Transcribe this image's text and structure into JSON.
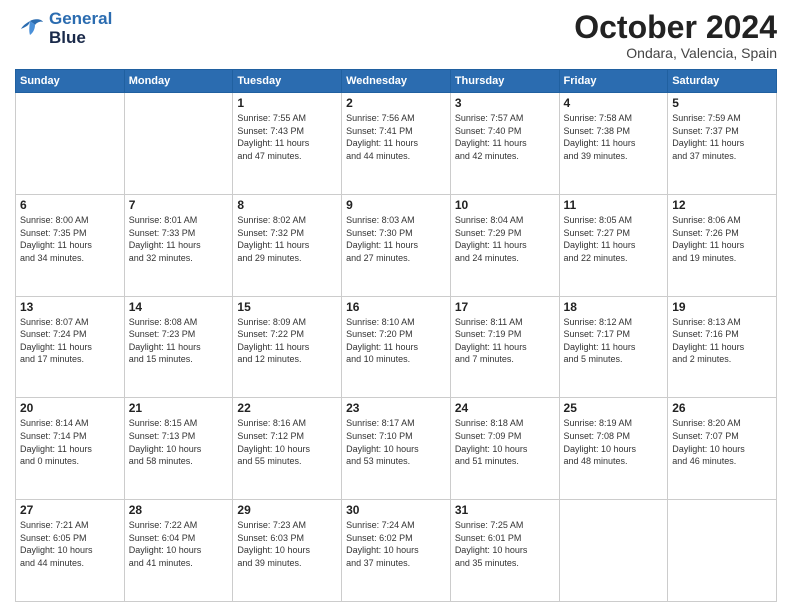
{
  "logo": {
    "line1": "General",
    "line2": "Blue"
  },
  "title": "October 2024",
  "location": "Ondara, Valencia, Spain",
  "weekdays": [
    "Sunday",
    "Monday",
    "Tuesday",
    "Wednesday",
    "Thursday",
    "Friday",
    "Saturday"
  ],
  "weeks": [
    [
      {
        "day": "",
        "info": ""
      },
      {
        "day": "",
        "info": ""
      },
      {
        "day": "1",
        "info": "Sunrise: 7:55 AM\nSunset: 7:43 PM\nDaylight: 11 hours\nand 47 minutes."
      },
      {
        "day": "2",
        "info": "Sunrise: 7:56 AM\nSunset: 7:41 PM\nDaylight: 11 hours\nand 44 minutes."
      },
      {
        "day": "3",
        "info": "Sunrise: 7:57 AM\nSunset: 7:40 PM\nDaylight: 11 hours\nand 42 minutes."
      },
      {
        "day": "4",
        "info": "Sunrise: 7:58 AM\nSunset: 7:38 PM\nDaylight: 11 hours\nand 39 minutes."
      },
      {
        "day": "5",
        "info": "Sunrise: 7:59 AM\nSunset: 7:37 PM\nDaylight: 11 hours\nand 37 minutes."
      }
    ],
    [
      {
        "day": "6",
        "info": "Sunrise: 8:00 AM\nSunset: 7:35 PM\nDaylight: 11 hours\nand 34 minutes."
      },
      {
        "day": "7",
        "info": "Sunrise: 8:01 AM\nSunset: 7:33 PM\nDaylight: 11 hours\nand 32 minutes."
      },
      {
        "day": "8",
        "info": "Sunrise: 8:02 AM\nSunset: 7:32 PM\nDaylight: 11 hours\nand 29 minutes."
      },
      {
        "day": "9",
        "info": "Sunrise: 8:03 AM\nSunset: 7:30 PM\nDaylight: 11 hours\nand 27 minutes."
      },
      {
        "day": "10",
        "info": "Sunrise: 8:04 AM\nSunset: 7:29 PM\nDaylight: 11 hours\nand 24 minutes."
      },
      {
        "day": "11",
        "info": "Sunrise: 8:05 AM\nSunset: 7:27 PM\nDaylight: 11 hours\nand 22 minutes."
      },
      {
        "day": "12",
        "info": "Sunrise: 8:06 AM\nSunset: 7:26 PM\nDaylight: 11 hours\nand 19 minutes."
      }
    ],
    [
      {
        "day": "13",
        "info": "Sunrise: 8:07 AM\nSunset: 7:24 PM\nDaylight: 11 hours\nand 17 minutes."
      },
      {
        "day": "14",
        "info": "Sunrise: 8:08 AM\nSunset: 7:23 PM\nDaylight: 11 hours\nand 15 minutes."
      },
      {
        "day": "15",
        "info": "Sunrise: 8:09 AM\nSunset: 7:22 PM\nDaylight: 11 hours\nand 12 minutes."
      },
      {
        "day": "16",
        "info": "Sunrise: 8:10 AM\nSunset: 7:20 PM\nDaylight: 11 hours\nand 10 minutes."
      },
      {
        "day": "17",
        "info": "Sunrise: 8:11 AM\nSunset: 7:19 PM\nDaylight: 11 hours\nand 7 minutes."
      },
      {
        "day": "18",
        "info": "Sunrise: 8:12 AM\nSunset: 7:17 PM\nDaylight: 11 hours\nand 5 minutes."
      },
      {
        "day": "19",
        "info": "Sunrise: 8:13 AM\nSunset: 7:16 PM\nDaylight: 11 hours\nand 2 minutes."
      }
    ],
    [
      {
        "day": "20",
        "info": "Sunrise: 8:14 AM\nSunset: 7:14 PM\nDaylight: 11 hours\nand 0 minutes."
      },
      {
        "day": "21",
        "info": "Sunrise: 8:15 AM\nSunset: 7:13 PM\nDaylight: 10 hours\nand 58 minutes."
      },
      {
        "day": "22",
        "info": "Sunrise: 8:16 AM\nSunset: 7:12 PM\nDaylight: 10 hours\nand 55 minutes."
      },
      {
        "day": "23",
        "info": "Sunrise: 8:17 AM\nSunset: 7:10 PM\nDaylight: 10 hours\nand 53 minutes."
      },
      {
        "day": "24",
        "info": "Sunrise: 8:18 AM\nSunset: 7:09 PM\nDaylight: 10 hours\nand 51 minutes."
      },
      {
        "day": "25",
        "info": "Sunrise: 8:19 AM\nSunset: 7:08 PM\nDaylight: 10 hours\nand 48 minutes."
      },
      {
        "day": "26",
        "info": "Sunrise: 8:20 AM\nSunset: 7:07 PM\nDaylight: 10 hours\nand 46 minutes."
      }
    ],
    [
      {
        "day": "27",
        "info": "Sunrise: 7:21 AM\nSunset: 6:05 PM\nDaylight: 10 hours\nand 44 minutes."
      },
      {
        "day": "28",
        "info": "Sunrise: 7:22 AM\nSunset: 6:04 PM\nDaylight: 10 hours\nand 41 minutes."
      },
      {
        "day": "29",
        "info": "Sunrise: 7:23 AM\nSunset: 6:03 PM\nDaylight: 10 hours\nand 39 minutes."
      },
      {
        "day": "30",
        "info": "Sunrise: 7:24 AM\nSunset: 6:02 PM\nDaylight: 10 hours\nand 37 minutes."
      },
      {
        "day": "31",
        "info": "Sunrise: 7:25 AM\nSunset: 6:01 PM\nDaylight: 10 hours\nand 35 minutes."
      },
      {
        "day": "",
        "info": ""
      },
      {
        "day": "",
        "info": ""
      }
    ]
  ]
}
